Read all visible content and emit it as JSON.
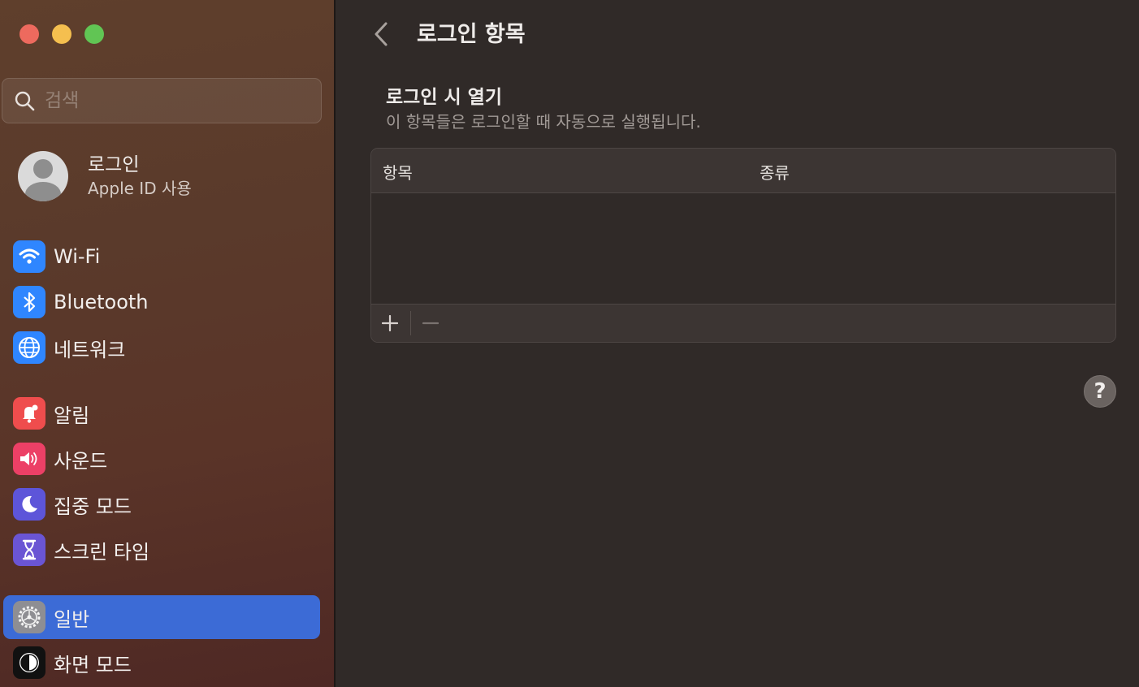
{
  "window": {
    "controls": [
      "close",
      "minimize",
      "zoom"
    ]
  },
  "sidebar": {
    "search": {
      "placeholder": "검색",
      "value": ""
    },
    "account": {
      "title": "로그인",
      "subtitle": "Apple ID 사용"
    },
    "items": [
      {
        "label": "Wi-Fi",
        "icon": "wifi-icon",
        "color": "#2f86ff",
        "selected": false
      },
      {
        "label": "Bluetooth",
        "icon": "bluetooth-icon",
        "color": "#2f86ff",
        "selected": false
      },
      {
        "label": "네트워크",
        "icon": "globe-icon",
        "color": "#2f86ff",
        "selected": false
      },
      {
        "label": "알림",
        "icon": "bell-icon",
        "color": "#ef4d4d",
        "selected": false
      },
      {
        "label": "사운드",
        "icon": "speaker-icon",
        "color": "#ec4066",
        "selected": false
      },
      {
        "label": "집중 모드",
        "icon": "moon-icon",
        "color": "#5d55d9",
        "selected": false
      },
      {
        "label": "스크린 타임",
        "icon": "hourglass-icon",
        "color": "#6a55d4",
        "selected": false
      },
      {
        "label": "일반",
        "icon": "gear-icon",
        "color": "#8e8e93",
        "selected": true
      },
      {
        "label": "화면 모드",
        "icon": "appearance-icon",
        "color": "#111111",
        "selected": false
      }
    ]
  },
  "main": {
    "title": "로그인 항목",
    "section": {
      "title": "로그인 시 열기",
      "description": "이 항목들은 로그인할 때 자동으로 실행됩니다."
    },
    "table": {
      "columns": [
        "항목",
        "종류"
      ],
      "rows": [],
      "add_label": "+",
      "remove_label": "−"
    },
    "help_label": "?"
  },
  "colors": {
    "accent": "#3c6bd6",
    "background": "#302a28"
  }
}
